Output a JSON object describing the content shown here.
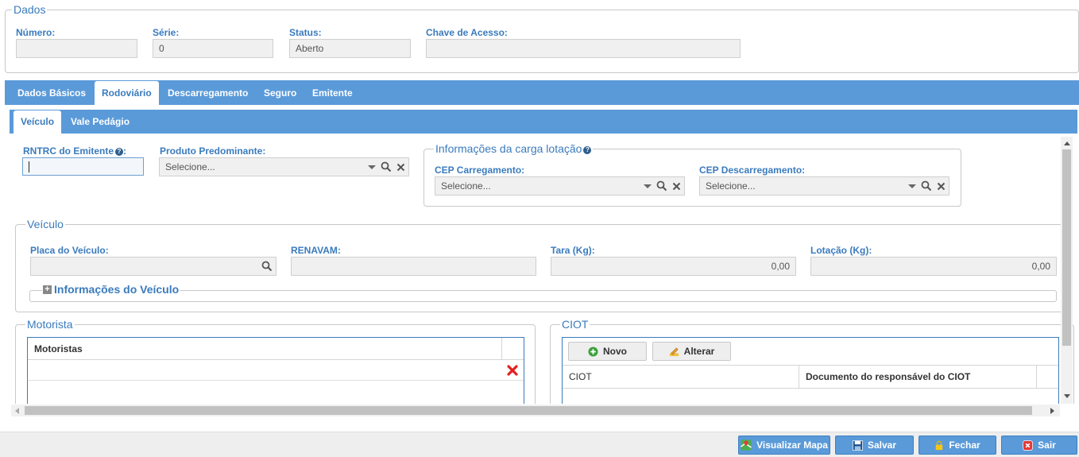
{
  "dados": {
    "legend": "Dados",
    "numero_label": "Número:",
    "numero_value": "",
    "serie_label": "Série:",
    "serie_value": "0",
    "status_label": "Status:",
    "status_value": "Aberto",
    "chave_label": "Chave de Acesso:",
    "chave_value": ""
  },
  "main_tabs": [
    {
      "label": "Dados Básicos",
      "active": false
    },
    {
      "label": "Rodoviário",
      "active": true
    },
    {
      "label": "Descarregamento",
      "active": false
    },
    {
      "label": "Seguro",
      "active": false
    },
    {
      "label": "Emitente",
      "active": false
    }
  ],
  "sub_tabs": [
    {
      "label": "Veículo",
      "active": true
    },
    {
      "label": "Vale Pedágio",
      "active": false
    }
  ],
  "rntrc": {
    "label": "RNTRC do Emitente",
    "suffix": ":",
    "value": ""
  },
  "produto": {
    "label": "Produto Predominante:",
    "placeholder": "Selecione..."
  },
  "carga": {
    "legend": "Informações da carga lotação",
    "cep_carregamento_label": "CEP Carregamento:",
    "cep_carregamento_placeholder": "Selecione...",
    "cep_descarregamento_label": "CEP Descarregamento:",
    "cep_descarregamento_placeholder": "Selecione..."
  },
  "veiculo": {
    "legend": "Veículo",
    "placa_label": "Placa do Veículo:",
    "placa_value": "",
    "renavam_label": "RENAVAM:",
    "renavam_value": "",
    "tara_label": "Tara (Kg):",
    "tara_value": "0,00",
    "lotacao_label": "Lotação (Kg):",
    "lotacao_value": "0,00",
    "info_legend": "Informações do Veículo"
  },
  "motorista": {
    "legend": "Motorista",
    "col_motoristas": "Motoristas"
  },
  "ciot": {
    "legend": "CIOT",
    "novo_label": "Novo",
    "alterar_label": "Alterar",
    "col_ciot": "CIOT",
    "col_documento": "Documento do responsável do CIOT"
  },
  "footer": {
    "visualizar_mapa": "Visualizar Mapa",
    "salvar": "Salvar",
    "fechar": "Fechar",
    "sair": "Sair"
  },
  "colors": {
    "accent": "#5a9ad9",
    "label": "#3a7bbd",
    "delete": "#e02020",
    "novo_green": "#3aa03a"
  }
}
